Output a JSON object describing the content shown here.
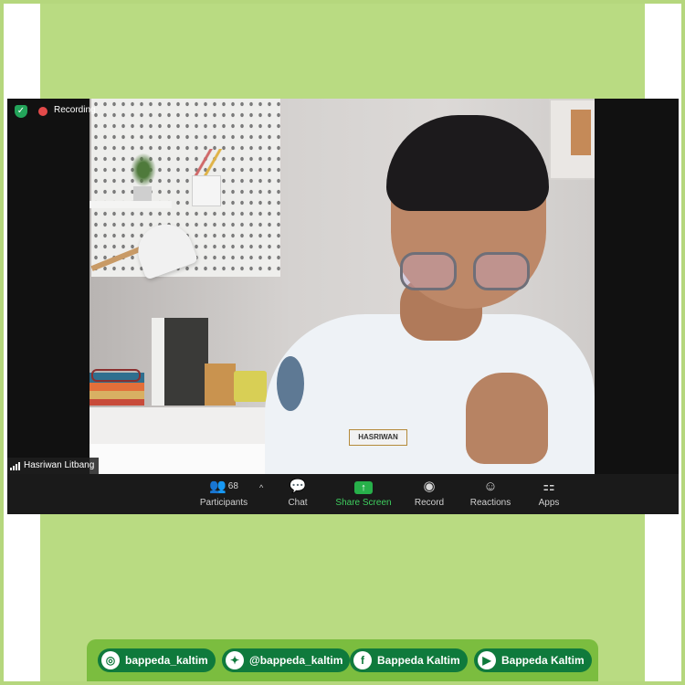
{
  "meeting": {
    "recording_label": "Recording",
    "participant_name": "Hasriwan Litbang",
    "shirt_badge": "HASRIWAN"
  },
  "toolbar": {
    "participants_label": "Participants",
    "participants_count": "68",
    "chat_label": "Chat",
    "share_screen_label": "Share Screen",
    "record_label": "Record",
    "reactions_label": "Reactions",
    "apps_label": "Apps"
  },
  "social": {
    "instagram": "bappeda_kaltim",
    "twitter": "@bappeda_kaltim",
    "facebook": "Bappeda Kaltim",
    "youtube": "Bappeda Kaltim"
  },
  "colors": {
    "frame_green": "#b9db82",
    "footer_green": "#7bbd3f",
    "pill_green": "#0f7a3c",
    "share_green": "#3fcf5f",
    "recording_red": "#e34a4a"
  }
}
